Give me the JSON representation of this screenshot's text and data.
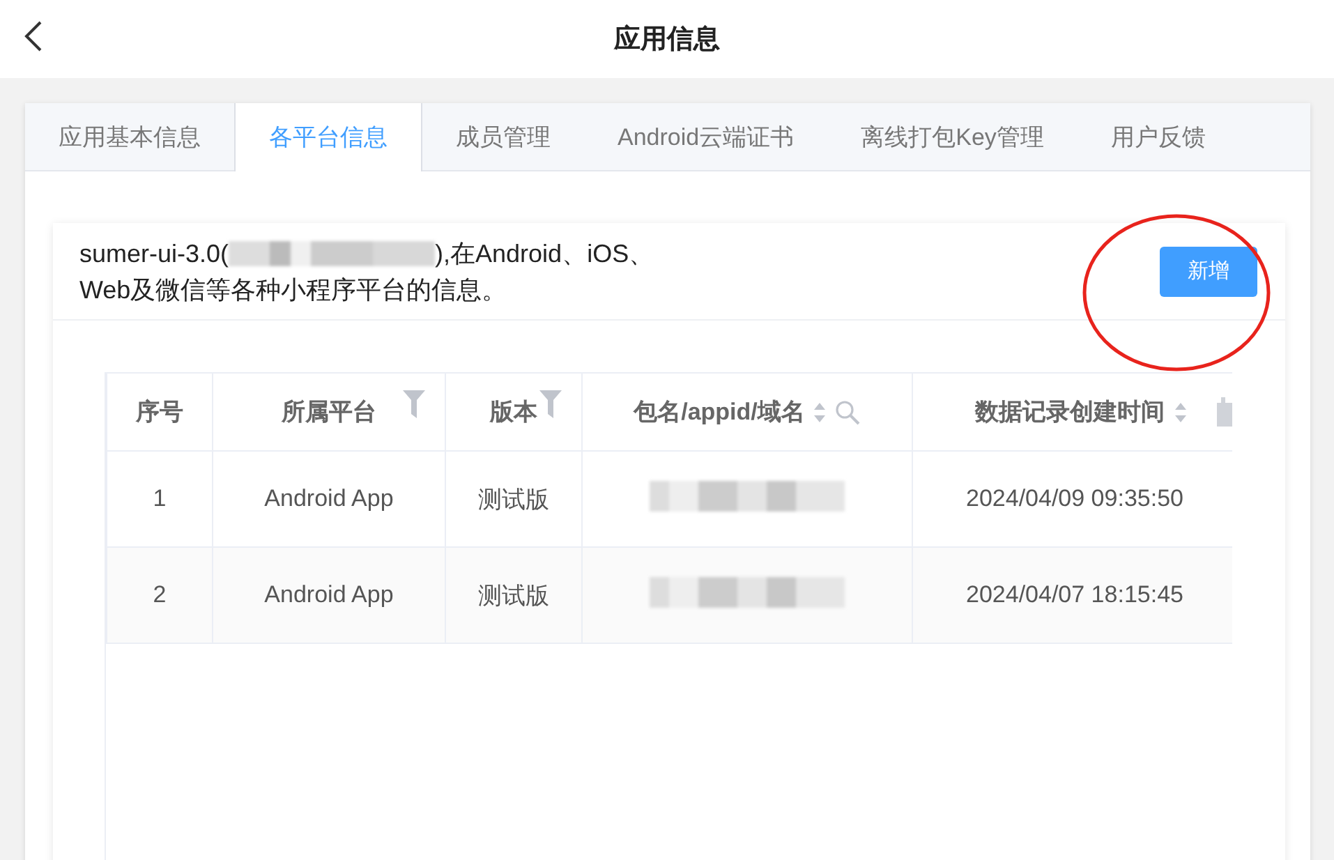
{
  "header": {
    "title": "应用信息"
  },
  "tabs": [
    {
      "label": "应用基本信息",
      "selected": false
    },
    {
      "label": "各平台信息",
      "selected": true
    },
    {
      "label": "成员管理",
      "selected": false
    },
    {
      "label": "Android云端证书",
      "selected": false
    },
    {
      "label": "离线打包Key管理",
      "selected": false
    },
    {
      "label": "用户反馈",
      "selected": false
    }
  ],
  "description": {
    "prefix": "sumer-ui-3.0(",
    "lines": [
      "),在Android、iOS、",
      "Web及微信等各种小程序平台的信息。"
    ]
  },
  "add_button": "新增",
  "table": {
    "columns": [
      {
        "label": "序号",
        "kind": "plain",
        "sortable": false
      },
      {
        "label": "所属平台",
        "kind": "filter",
        "sortable": false
      },
      {
        "label": "版本",
        "kind": "filter",
        "sortable": false
      },
      {
        "label": "包名/appid/域名",
        "kind": "search",
        "sortable": true
      },
      {
        "label": "数据记录创建时间",
        "kind": "date",
        "sortable": true
      }
    ],
    "rows": [
      {
        "index": "1",
        "platform": "Android App",
        "version": "测试版",
        "created": "2024/04/09 09:35:50"
      },
      {
        "index": "2",
        "platform": "Android App",
        "version": "测试版",
        "created": "2024/04/07 18:15:45"
      }
    ]
  }
}
